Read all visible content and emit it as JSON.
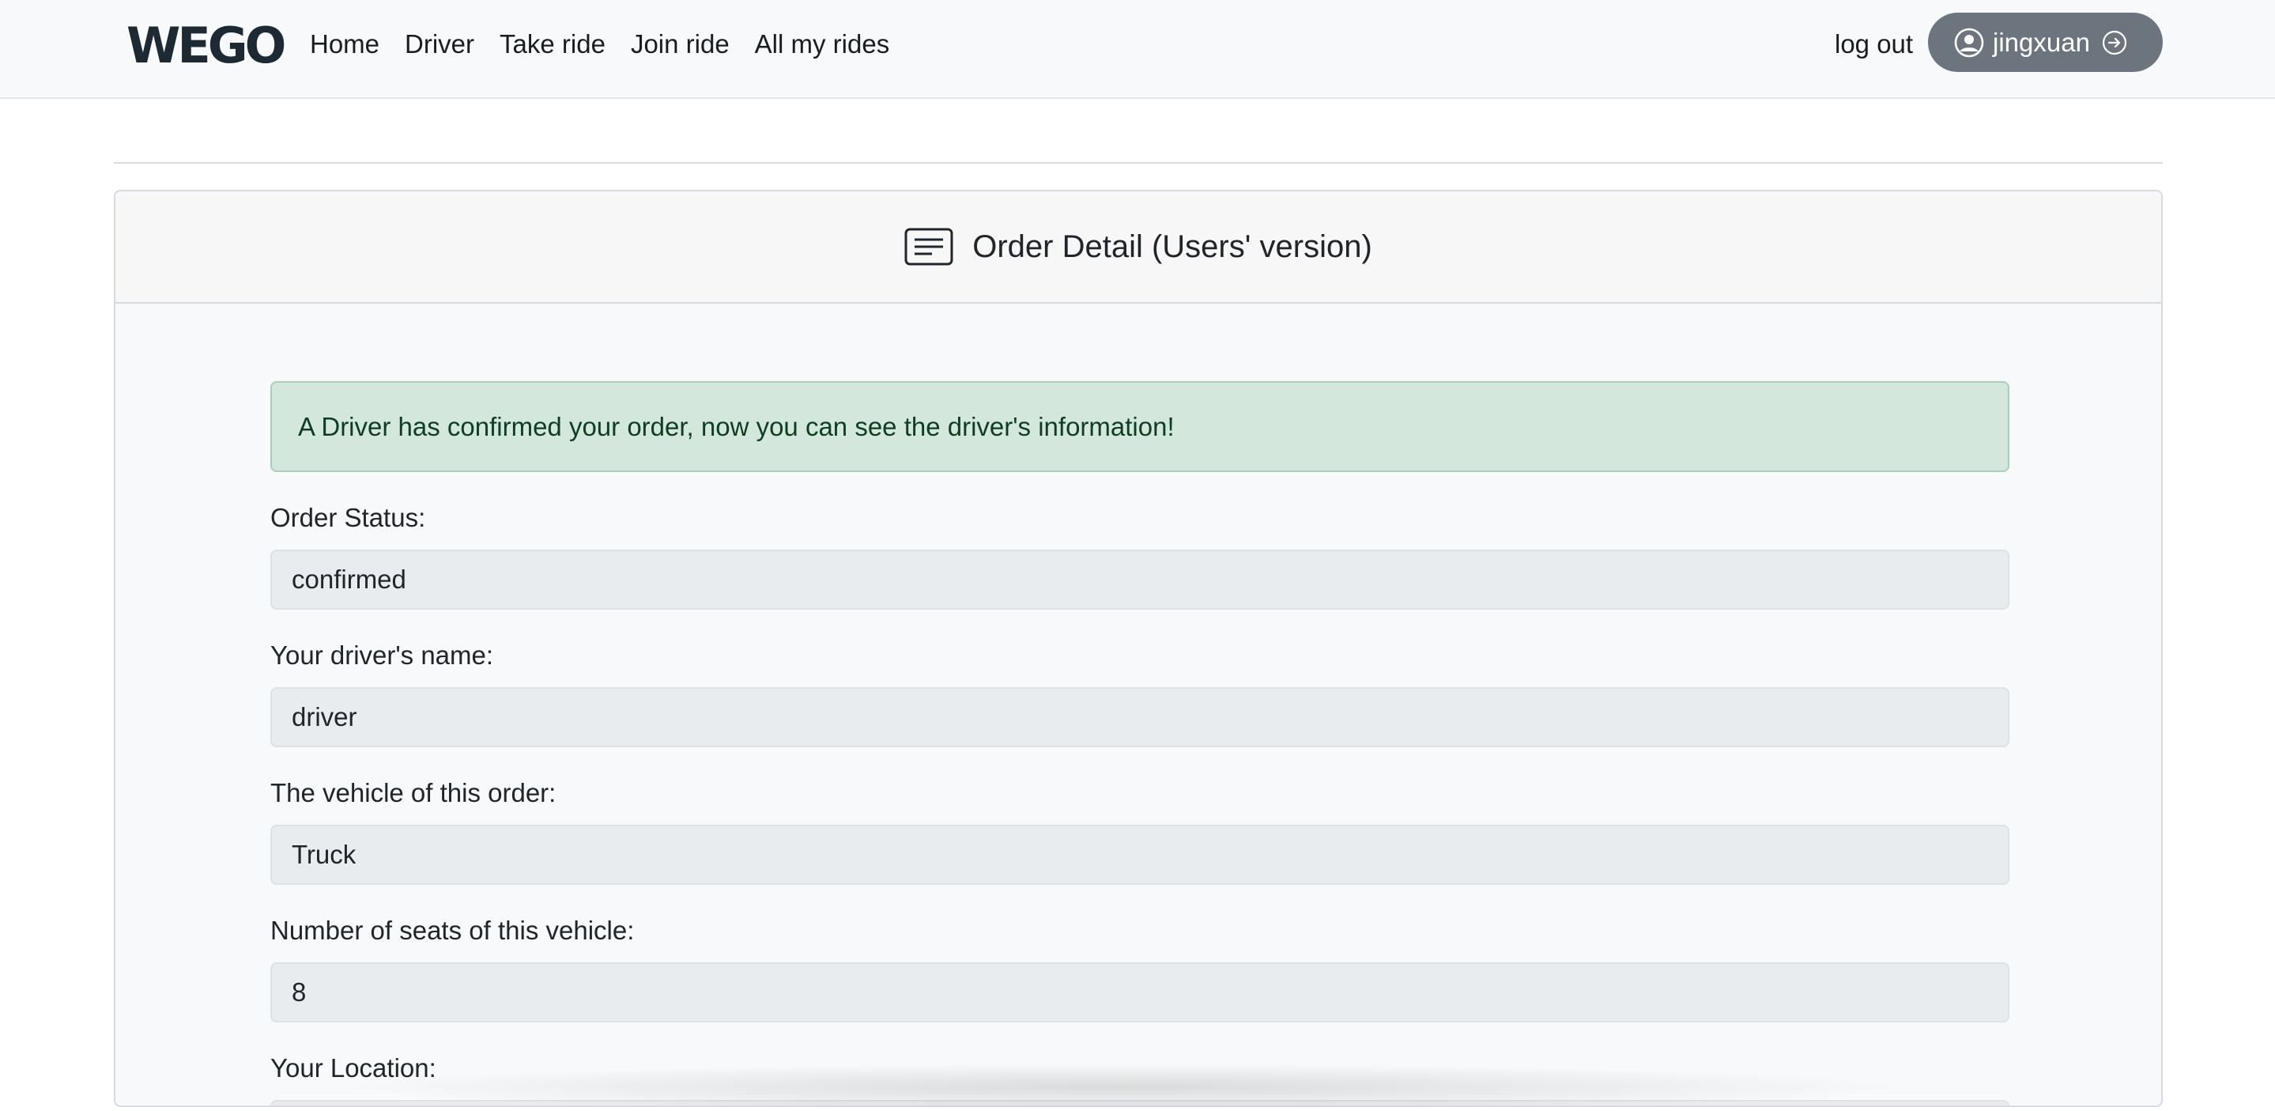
{
  "navbar": {
    "brand": "WEGO",
    "links": [
      "Home",
      "Driver",
      "Take ride",
      "Join ride",
      "All my rides"
    ],
    "logout_label": "log out",
    "username": "jingxuan"
  },
  "card": {
    "title": "Order Detail (Users' version)",
    "alert_text": "A Driver has confirmed your order, now you can see the driver's information!",
    "fields": [
      {
        "label": "Order Status:",
        "value": "confirmed"
      },
      {
        "label": "Your driver's name:",
        "value": "driver"
      },
      {
        "label": "The vehicle of this order:",
        "value": "Truck"
      },
      {
        "label": "Number of seats of this vehicle:",
        "value": "8"
      },
      {
        "label": "Your Location:",
        "value": ""
      }
    ]
  },
  "colors": {
    "navbar_bg": "#f8f9fa",
    "user_pill_bg": "#6c757d",
    "alert_bg": "#d4e7dd",
    "field_bg": "#e9ecef"
  },
  "icons": {
    "avatar": "person-circle-icon",
    "user_arrow": "arrow-right-circle-icon",
    "card_header": "card-text-icon"
  }
}
